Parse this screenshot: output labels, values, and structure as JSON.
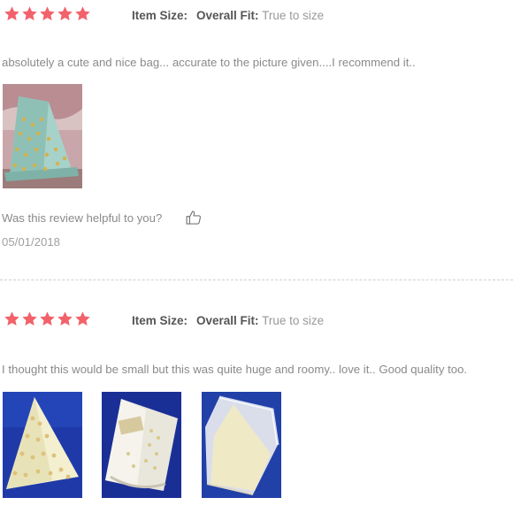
{
  "colors": {
    "star": "#f2626b",
    "label": "#555555",
    "muted": "#8a8a8a"
  },
  "reviews": [
    {
      "stars": 5,
      "item_size_label": "Item Size:",
      "overall_fit_label": "Overall Fit:",
      "overall_fit_value": "True to size",
      "text": "absolutely a cute and nice bag... accurate to the picture given....I recommend it..",
      "helpful_prompt": "Was this review helpful to you?",
      "helpful_icon": "thumbs-up-icon",
      "date": "05/01/2018",
      "photos": [
        "bag-photo-1"
      ]
    },
    {
      "stars": 5,
      "item_size_label": "Item Size:",
      "overall_fit_label": "Overall Fit:",
      "overall_fit_value": "True to size",
      "text": "I thought this would be small but this was quite huge and roomy.. love it.. Good quality too.",
      "photos": [
        "bag-photo-1",
        "bag-photo-2",
        "bag-photo-3"
      ]
    }
  ]
}
